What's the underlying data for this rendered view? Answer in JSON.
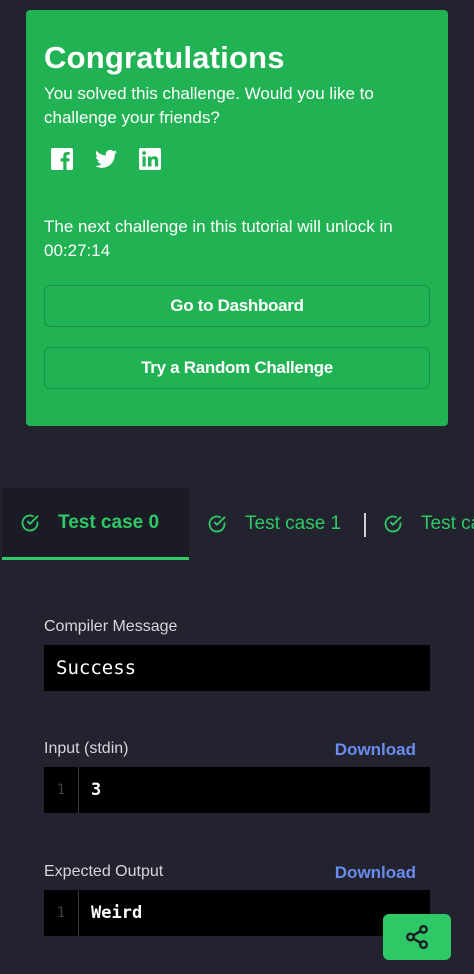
{
  "congrats": {
    "title": "Congratulations",
    "subtitle": "You solved this challenge. Would you like to challenge your friends?",
    "social": [
      "facebook-icon",
      "twitter-icon",
      "linkedin-icon"
    ],
    "unlock_text": "The next challenge in this tutorial will unlock in 00:27:14",
    "dashboard_label": "Go to Dashboard",
    "random_label": "Try a Random Challenge",
    "bg_color": "#21b353"
  },
  "tabs": [
    {
      "label": "Test case 0",
      "active": true
    },
    {
      "label": "Test case 1",
      "active": false
    },
    {
      "label": "Test ca",
      "active": false
    }
  ],
  "compiler": {
    "label": "Compiler Message",
    "value": "Success"
  },
  "input": {
    "label": "Input (stdin)",
    "download": "Download",
    "line": "1",
    "value": "3"
  },
  "expected": {
    "label": "Expected Output",
    "download": "Download",
    "line": "1",
    "value": "Weird"
  },
  "colors": {
    "accent": "#2ec866",
    "link": "#6a8cf0",
    "background": "#23232f"
  }
}
